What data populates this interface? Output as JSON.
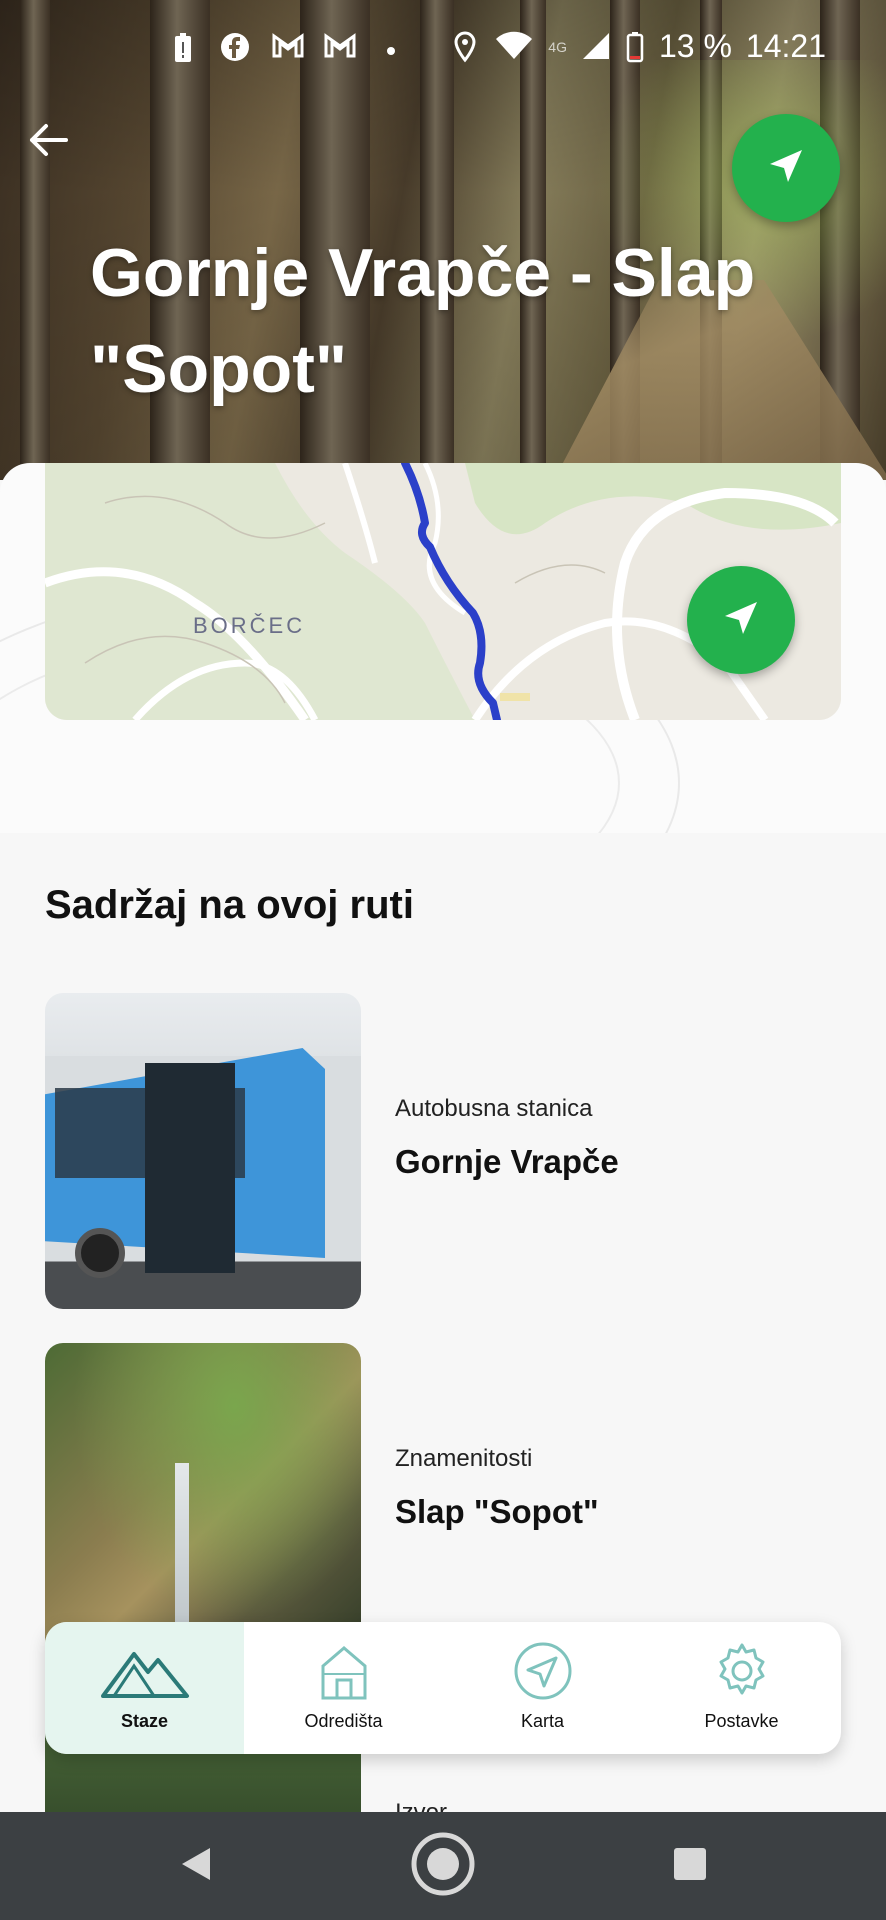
{
  "status_bar": {
    "battery_percent": "13 %",
    "time": "14:21",
    "network": "4G"
  },
  "hero": {
    "title": "Gornje Vrapče - Slap \"Sopot\""
  },
  "map": {
    "place_label": "BORČEC"
  },
  "content": {
    "section_title": "Sadržaj na ovoj ruti",
    "items": [
      {
        "category": "Autobusna stanica",
        "name": "Gornje Vrapče"
      },
      {
        "category": "Znamenitosti",
        "name": "Slap \"Sopot\""
      },
      {
        "category": "Izvor",
        "name": ""
      }
    ]
  },
  "tabbar": {
    "tabs": [
      {
        "label": "Staze",
        "icon": "mountain-icon",
        "active": true
      },
      {
        "label": "Odredišta",
        "icon": "house-icon",
        "active": false
      },
      {
        "label": "Karta",
        "icon": "navigation-arrow-icon",
        "active": false
      },
      {
        "label": "Postavke",
        "icon": "gear-icon",
        "active": false
      }
    ]
  },
  "colors": {
    "accent_green": "#23b14d",
    "route_blue": "#2b40c9",
    "active_tab_bg": "#e5f5ef",
    "icon_teal": "#2b7a78"
  }
}
